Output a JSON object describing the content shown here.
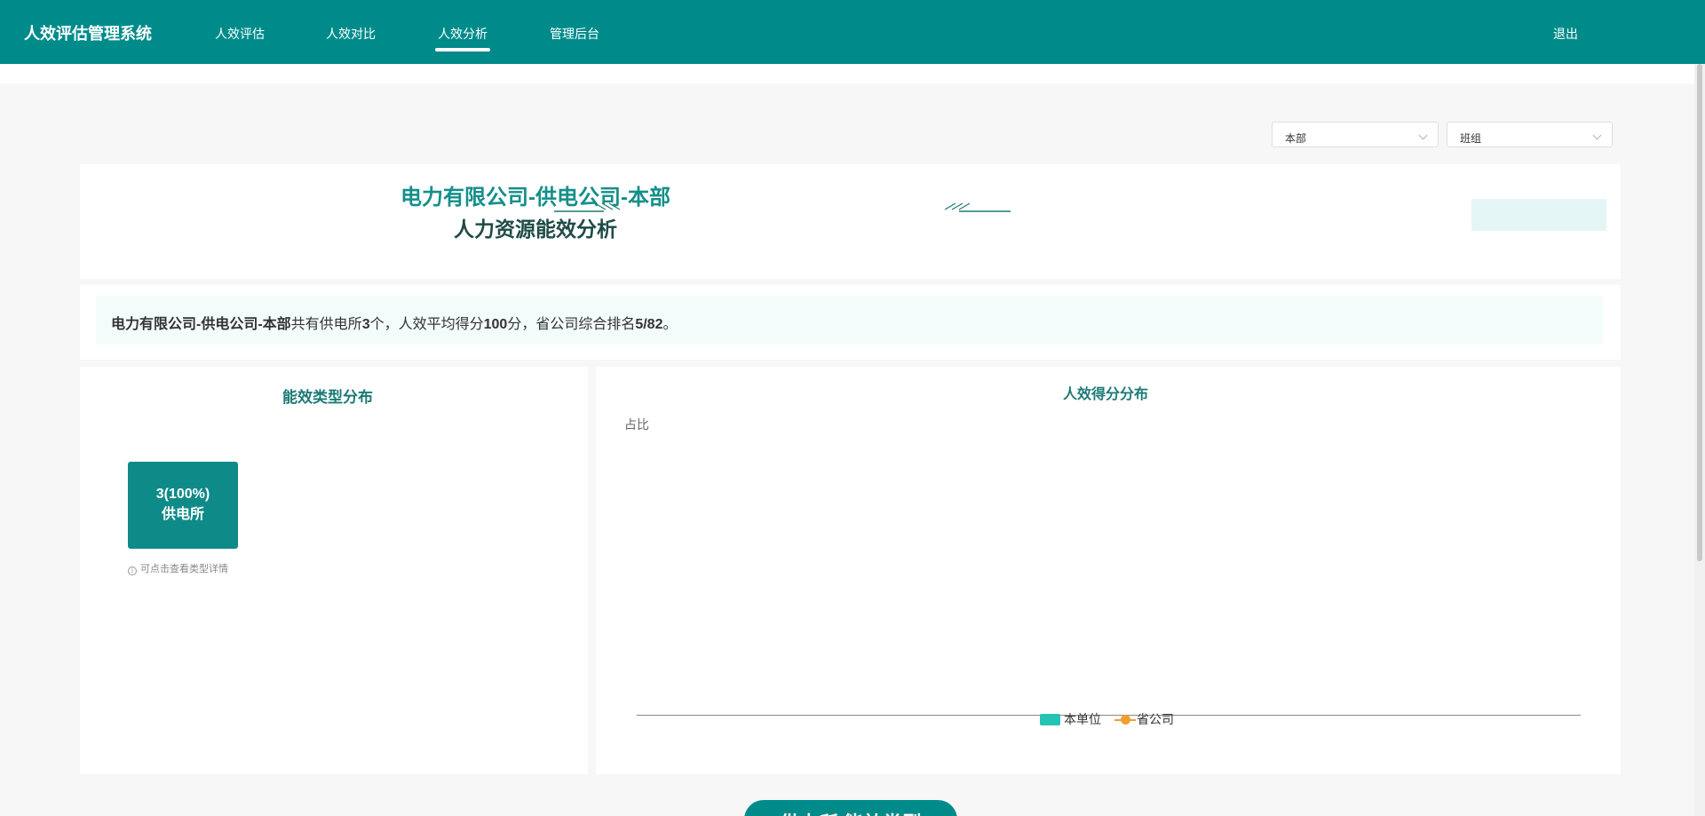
{
  "header": {
    "brand": "人效评估管理系统",
    "nav": [
      {
        "label": "人效评估",
        "active": false
      },
      {
        "label": "人效对比",
        "active": false
      },
      {
        "label": "人效分析",
        "active": true
      },
      {
        "label": "管理后台",
        "active": false
      }
    ],
    "logout": "退出"
  },
  "filters": {
    "unit_select": "本部",
    "group_select": "班组"
  },
  "banner": {
    "title_line1": "电力有限公司-供电公司-本部",
    "title_line2": "人力资源能效分析"
  },
  "summary": {
    "unit": "电力有限公司-供电公司-本部",
    "text1": "共有供电所",
    "count": "3",
    "text2": "个，人效平均得分",
    "score": "100",
    "text3": "分，省公司综合排名",
    "rank": "5/82",
    "text4": "。"
  },
  "type_panel": {
    "title": "能效类型分布",
    "box_value": "3(100%)",
    "box_label": "供电所",
    "hint_icon": "i",
    "hint": "可点击查看类型详情"
  },
  "score_panel": {
    "title": "人效得分分布",
    "ylabel": "占比",
    "legend": [
      "本单位",
      "省公司"
    ]
  },
  "colors": {
    "primary": "#008b8b",
    "legend_unit": "#24c3b3",
    "legend_province": "#f0a030"
  },
  "bottom_section": {
    "title": "供电所 能效类型"
  }
}
